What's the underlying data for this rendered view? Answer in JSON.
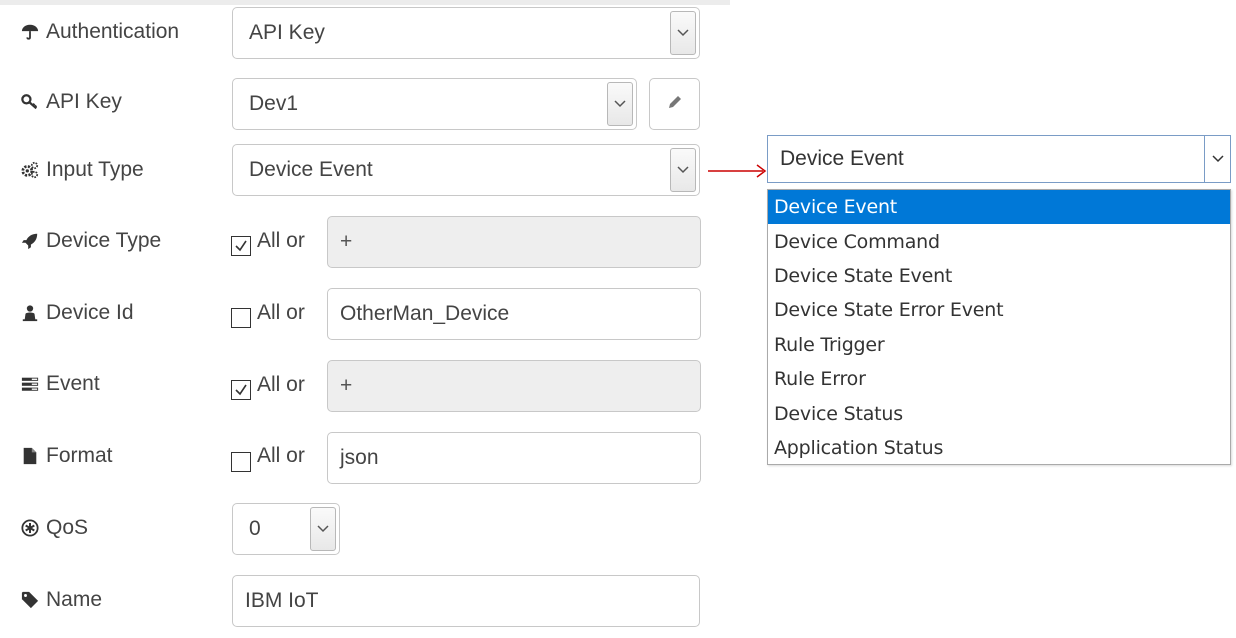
{
  "form": {
    "authentication": {
      "label": "Authentication",
      "value": "API Key",
      "icon": "umbrella-icon"
    },
    "api_key": {
      "label": "API Key",
      "value": "Dev1",
      "icon": "key-icon",
      "edit_icon": "pencil-icon"
    },
    "input_type": {
      "label": "Input Type",
      "value": "Device Event",
      "icon": "gears-icon"
    },
    "device_type": {
      "label": "Device Type",
      "all_or": "All or",
      "checked": true,
      "value": "+",
      "icon": "rocket-icon"
    },
    "device_id": {
      "label": "Device Id",
      "all_or": "All or",
      "checked": false,
      "value": "OtherMan_Device",
      "icon": "user-icon"
    },
    "event": {
      "label": "Event",
      "all_or": "All or",
      "checked": true,
      "value": "+",
      "icon": "list-icon"
    },
    "format": {
      "label": "Format",
      "all_or": "All or",
      "checked": false,
      "value": "json",
      "icon": "file-icon"
    },
    "qos": {
      "label": "QoS",
      "value": "0",
      "icon": "asterisk-circle-icon"
    },
    "name": {
      "label": "Name",
      "value": "IBM IoT",
      "icon": "tag-icon"
    }
  },
  "dropdown": {
    "selected": "Device Event",
    "options": [
      "Device Event",
      "Device Command",
      "Device State Event",
      "Device State Error Event",
      "Rule Trigger",
      "Rule Error",
      "Device Status",
      "Application Status"
    ],
    "highlight_color": "#0078d7"
  },
  "colors": {
    "arrow": "#cc0000"
  }
}
